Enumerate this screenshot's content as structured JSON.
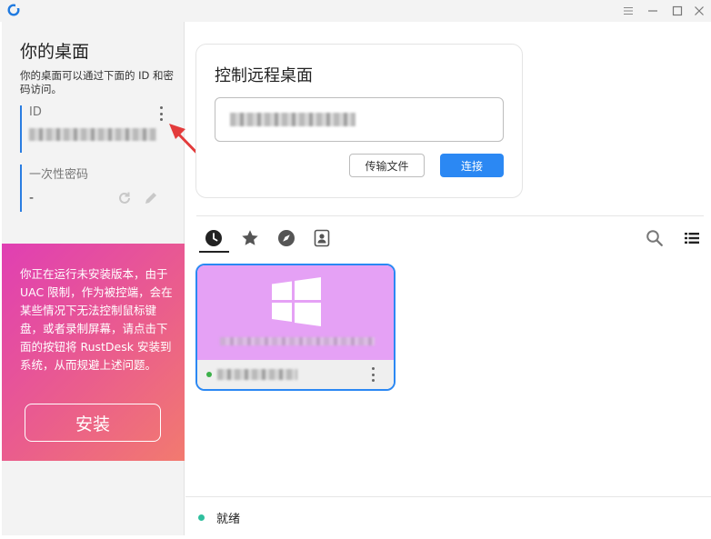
{
  "sidebar": {
    "title": "你的桌面",
    "description": "你的桌面可以通过下面的 ID 和密码访问。",
    "id_label": "ID",
    "password_label": "一次性密码",
    "password_value": "-"
  },
  "promo": {
    "text": "你正在运行未安装版本，由于 UAC 限制，作为被控端，会在某些情况下无法控制鼠标键盘，或者录制屏幕，请点击下面的按钮将 RustDesk 安装到系统，从而规避上述问题。",
    "install_label": "安装"
  },
  "connect": {
    "title": "控制远程桌面",
    "transfer_label": "传输文件",
    "connect_label": "连接"
  },
  "tabs": [
    {
      "icon": "clock-icon",
      "active": true
    },
    {
      "icon": "star-icon",
      "active": false
    },
    {
      "icon": "compass-icon",
      "active": false
    },
    {
      "icon": "address-book-icon",
      "active": false
    }
  ],
  "peer": {
    "os": "windows",
    "online": true
  },
  "status": {
    "text": "就绪"
  },
  "colors": {
    "accent": "#2b88f3",
    "id_bar": "#2a7de1",
    "promo_start": "#e03fb3",
    "promo_end": "#f27a6f",
    "peer_preview": "#e5a1f5",
    "online": "#3cb04a",
    "ready": "#2fbf9e"
  }
}
